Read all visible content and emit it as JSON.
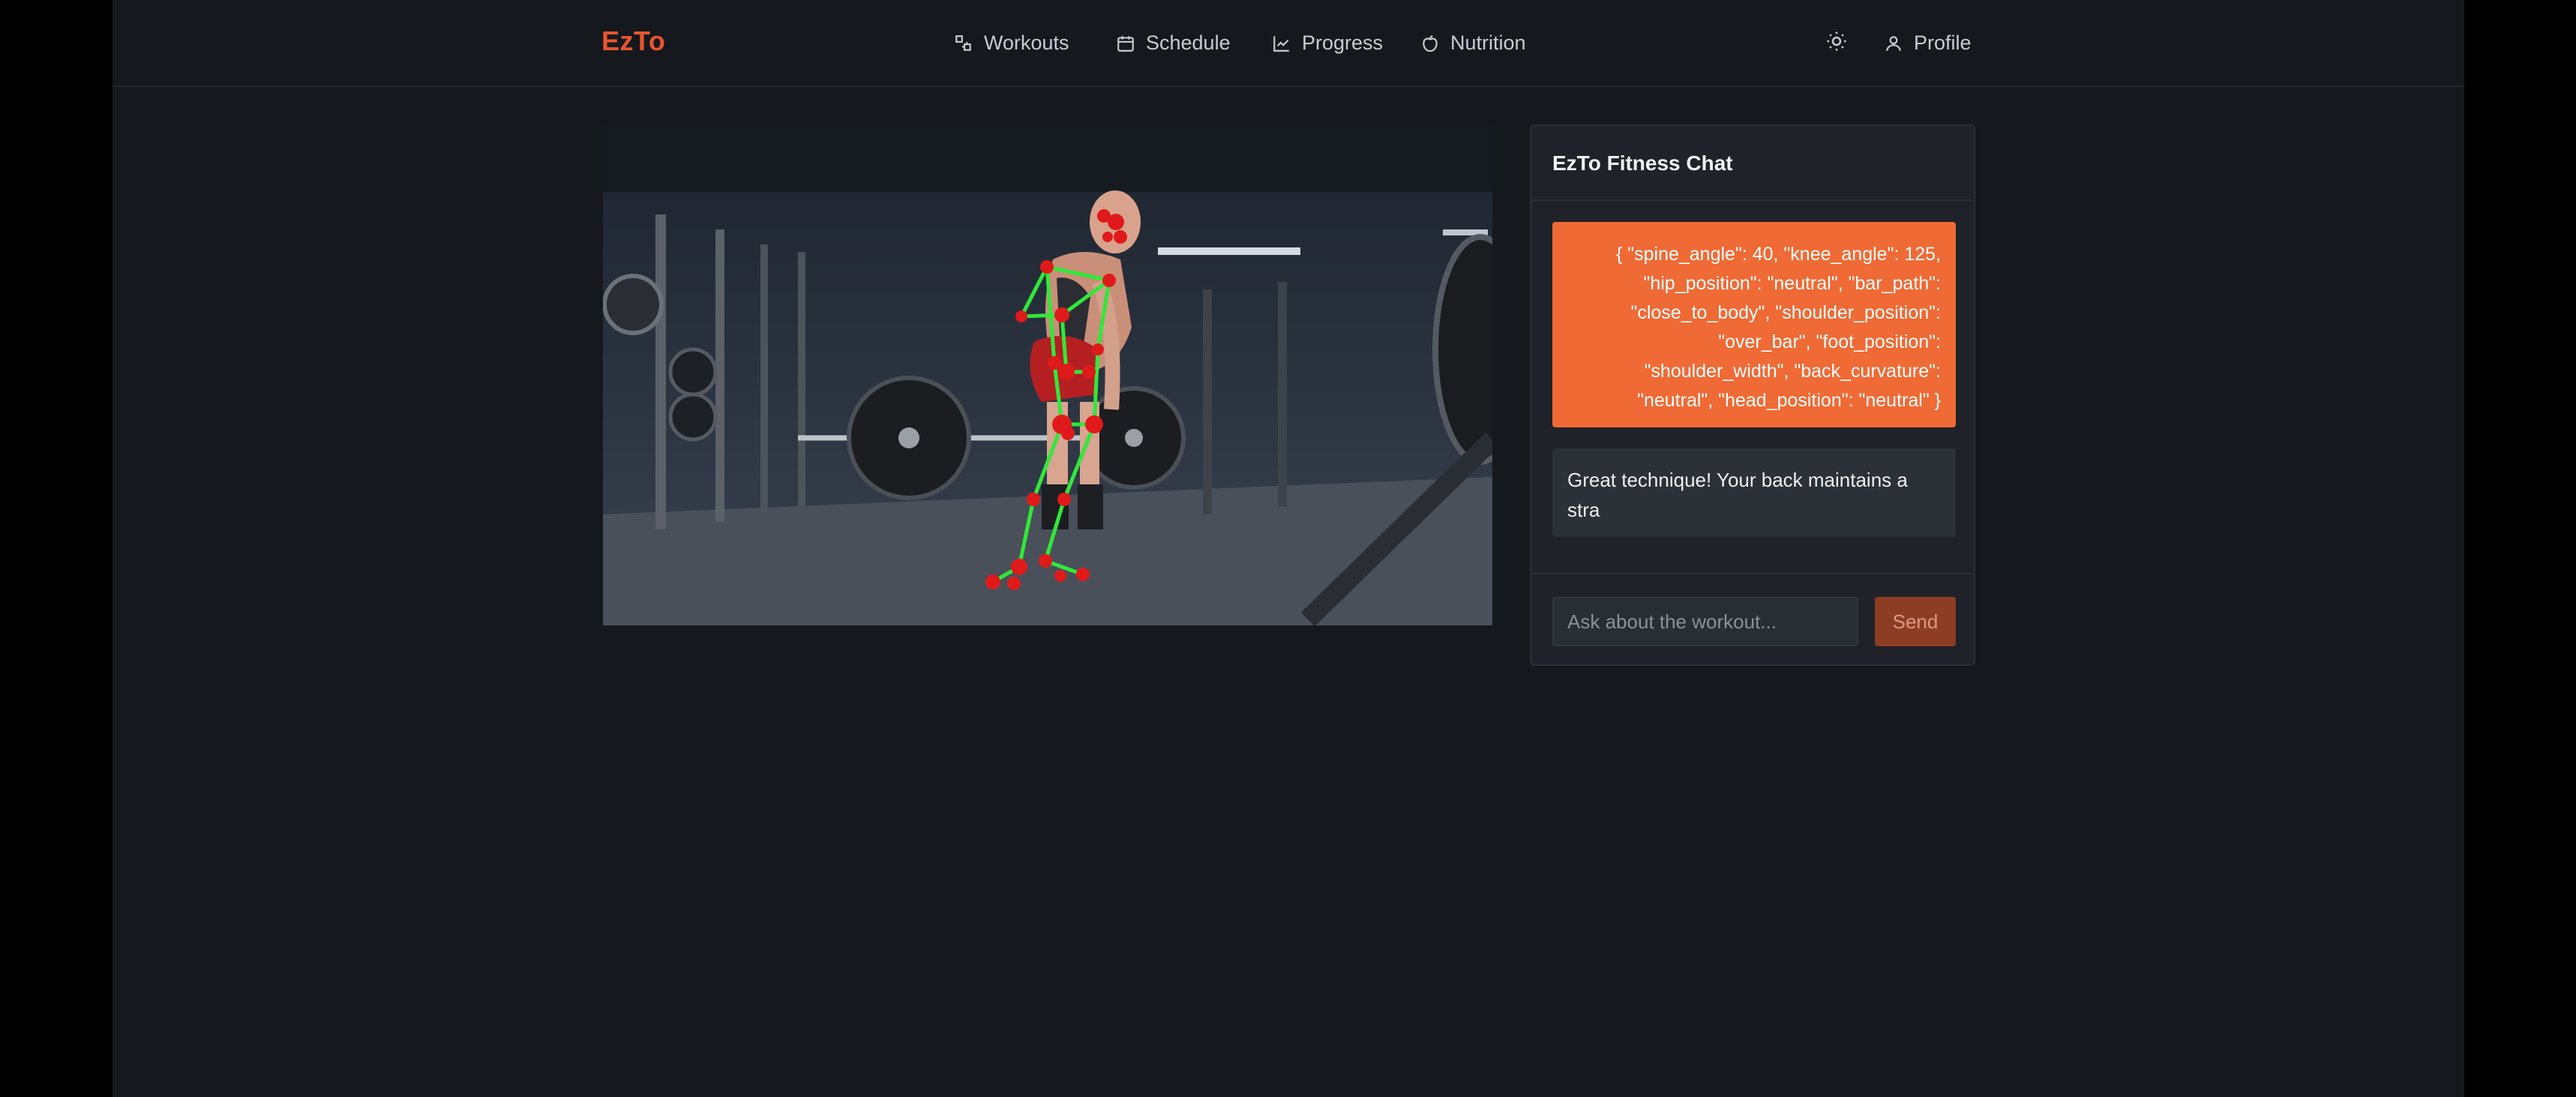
{
  "app": {
    "brand": "EzTo"
  },
  "nav": {
    "items": [
      {
        "label": "Workouts",
        "icon": "workouts-icon"
      },
      {
        "label": "Schedule",
        "icon": "calendar-icon"
      },
      {
        "label": "Progress",
        "icon": "chart-icon"
      },
      {
        "label": "Nutrition",
        "icon": "apple-icon"
      }
    ],
    "theme_toggle_icon": "sun-icon",
    "profile": {
      "label": "Profile",
      "icon": "user-icon"
    }
  },
  "video": {
    "subject": "person performing deadlift with pose-estimation skeleton overlay",
    "skeleton_line_color": "#31e83a",
    "joint_color": "#e01a1a"
  },
  "chat": {
    "title": "EzTo Fitness Chat",
    "messages": [
      {
        "role": "user",
        "lines": [
          "{ \"spine_angle\": 40, \"knee_angle\": 125,",
          "\"hip_position\": \"neutral\", \"bar_path\":",
          "\"close_to_body\", \"shoulder_position\":",
          "\"over_bar\", \"foot_position\":",
          "\"shoulder_width\", \"back_curvature\":",
          "\"neutral\", \"head_position\": \"neutral\" }"
        ]
      },
      {
        "role": "assistant",
        "lines": [
          "Great technique! Your back maintains a",
          "stra"
        ]
      }
    ],
    "input": {
      "placeholder": "Ask about the workout...",
      "value": ""
    },
    "send_label": "Send"
  },
  "colors": {
    "accent": "#e8552f",
    "user_bubble": "#ef6a35",
    "send_disabled": "#8e3d25",
    "background": "#15181d",
    "panel": "#1f2228"
  }
}
